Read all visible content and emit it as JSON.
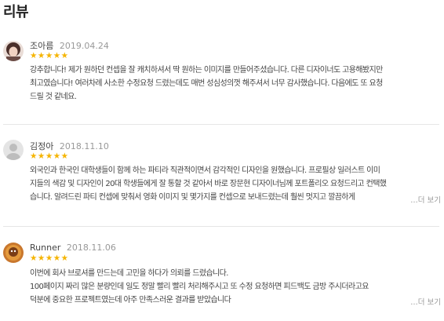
{
  "page": {
    "title": "리뷰"
  },
  "reviews": [
    {
      "name": "조아름",
      "date": "2019.04.24",
      "stars": "★★★★★",
      "lines": [
        "강추합니다! 제가 원하던 컨셉을 잘 캐치하셔서 딱 원하는 이미지를 만들어주셨습니다. 다른 디자이너도 고용해봤지만",
        "최고였습니다! 여러차례 사소한 수정요청 드렸는데도 매번 성심성의껏 해주셔서 너무 감사했습니다. 다음에도 또 요청",
        "드릴 것 같네요."
      ]
    },
    {
      "name": "김정아",
      "date": "2018.11.10",
      "stars": "★★★★★",
      "lines": [
        "외국인과 한국인 대학생들이 함께 하는 파티라 직관적이면서 감각적인 디자인을 원했습니다. 프로필상 일러스트 이미",
        "지들의 색감 및 디자인이 20대 학생들에게 잘 통할 것 같아서 바로 장문현 디자이너님께 포트폴리오 요청드리고 컨택했",
        "습니다. 알려드린 파티 컨셉에 맞춰서 영화 이미지 및 몇가지를 컨셉으로 보내드렸는데 훨씬 멋지고 깔끔하게"
      ],
      "more": "…더 보기"
    },
    {
      "name": "Runner",
      "date": "2018.11.06",
      "stars": "★★★★★",
      "lines": [
        "이번에 회사 브로셔를 만드는데 고민을 하다가 의뢰를 드렸습니다.",
        "100페이지 짜리 많은 분량인데 일도 정말 빨리 빨리 처리해주시고 또 수정 요청하면 피드백도 금방 주시더라고요",
        "덕분에 중요한 프로젝트였는데 아주 만족스러운 결과를 받았습니다"
      ],
      "more": "…더 보기"
    }
  ]
}
